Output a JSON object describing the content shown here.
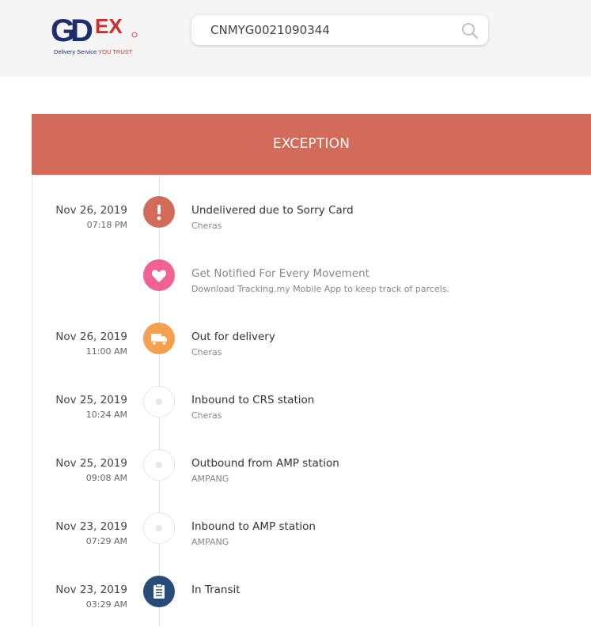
{
  "header": {
    "logo": {
      "brand": "GDEX",
      "tagline_prefix": "Delivery Service",
      "tagline_emphasis": "YOU TRUST"
    },
    "search": {
      "value": "CNMYG0021090344",
      "icon": "search-icon"
    }
  },
  "status": {
    "label": "EXCEPTION",
    "color": "#d36b5a"
  },
  "events": [
    {
      "date": "Nov 26, 2019",
      "time": "07:18 PM",
      "title": "Undelivered due to Sorry Card",
      "location": "Cheras",
      "icon": "exclamation-icon",
      "color": "#d36b5a"
    },
    {
      "date": "",
      "time": "",
      "title": "Get Notified For Every Movement",
      "location": "Download Tracking.my Mobile App to keep track of parcels.",
      "icon": "heart-icon",
      "color": "#f06292"
    },
    {
      "date": "Nov 26, 2019",
      "time": "11:00 AM",
      "title": "Out for delivery",
      "location": "Cheras",
      "icon": "truck-icon",
      "color": "#f5a04e"
    },
    {
      "date": "Nov 25, 2019",
      "time": "10:24 AM",
      "title": "Inbound to CRS station",
      "location": "Cheras",
      "icon": "dot-icon",
      "color": "#ffffff"
    },
    {
      "date": "Nov 25, 2019",
      "time": "09:08 AM",
      "title": "Outbound from AMP station",
      "location": "AMPANG",
      "icon": "dot-icon",
      "color": "#ffffff"
    },
    {
      "date": "Nov 23, 2019",
      "time": "07:29 AM",
      "title": "Inbound to AMP station",
      "location": "AMPANG",
      "icon": "dot-icon",
      "color": "#ffffff"
    },
    {
      "date": "Nov 23, 2019",
      "time": "03:29 AM",
      "title": "In Transit",
      "location": "",
      "icon": "clipboard-icon",
      "color": "#274c77"
    }
  ]
}
